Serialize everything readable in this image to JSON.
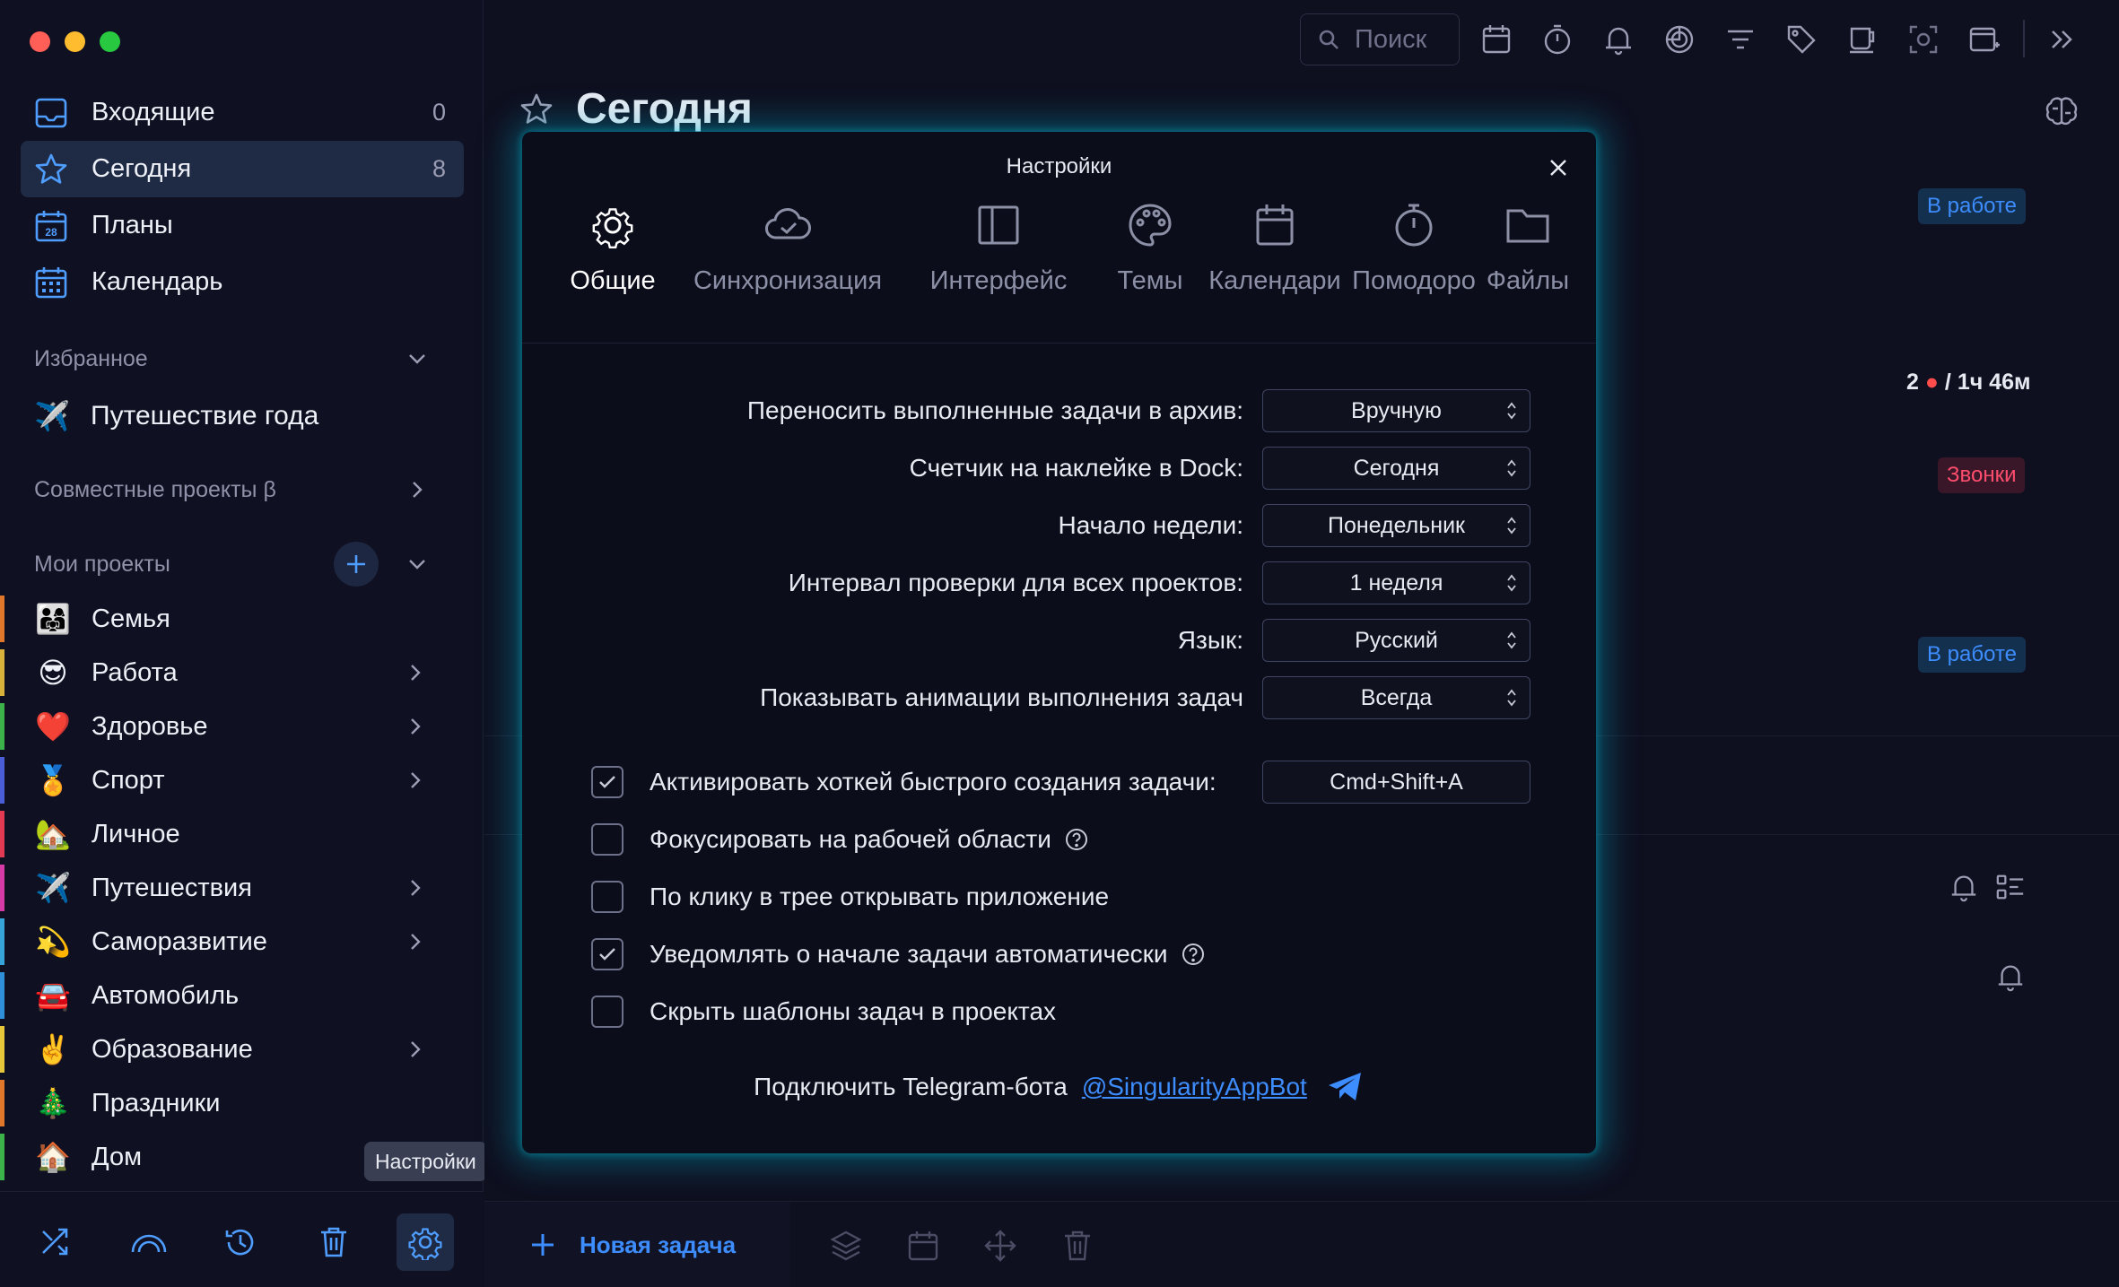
{
  "sidebar": {
    "nav": [
      {
        "label": "Входящие",
        "count": "0"
      },
      {
        "label": "Сегодня",
        "count": "8"
      },
      {
        "label": "Планы",
        "count": ""
      },
      {
        "label": "Календарь",
        "count": ""
      }
    ],
    "favorites_title": "Избранное",
    "favorites": [
      {
        "label": "Путешествие года",
        "emoji": "✈️"
      }
    ],
    "shared_title": "Совместные проекты β",
    "my_projects_title": "Мои проекты",
    "projects": [
      {
        "label": "Семья",
        "emoji": "👨‍👩‍👧",
        "color": "#e0772a",
        "expandable": false
      },
      {
        "label": "Работа",
        "emoji": "😎",
        "color": "#d8b23a",
        "expandable": true
      },
      {
        "label": "Здоровье",
        "emoji": "❤️",
        "color": "#3bb34a",
        "expandable": true
      },
      {
        "label": "Спорт",
        "emoji": "🏅",
        "color": "#4a5ed8",
        "expandable": true
      },
      {
        "label": "Личное",
        "emoji": "🏡",
        "color": "#e33a54",
        "expandable": false
      },
      {
        "label": "Путешествия",
        "emoji": "✈️",
        "color": "#d63aa6",
        "expandable": true
      },
      {
        "label": "Саморазвитие",
        "emoji": "💫",
        "color": "#36a3d9",
        "expandable": true
      },
      {
        "label": "Автомобиль",
        "emoji": "🚘",
        "color": "#2f8fd9",
        "expandable": false
      },
      {
        "label": "Образование",
        "emoji": "✌️",
        "color": "#e6c63a",
        "expandable": true
      },
      {
        "label": "Праздники",
        "emoji": "🎄",
        "color": "#e0772a",
        "expandable": false
      },
      {
        "label": "Дом",
        "emoji": "🏠",
        "color": "#3bb34a",
        "expandable": false
      }
    ],
    "tooltip": "Настройки"
  },
  "main": {
    "search_placeholder": "Поиск",
    "page_title": "Сегодня",
    "badges": {
      "in_work_1": "В работе",
      "calls": "Звонки",
      "in_work_2": "В работе"
    },
    "timer": {
      "count": "2",
      "dot": "●",
      "time": "/ 1ч 46м"
    },
    "new_task": "Новая задача"
  },
  "dialog": {
    "title": "Настройки",
    "tabs": [
      "Общие",
      "Синхронизация",
      "Интерфейс",
      "Темы",
      "Календари",
      "Помодоро",
      "Файлы"
    ],
    "active_tab": "Общие",
    "settings": [
      {
        "label": "Переносить выполненные задачи в архив:",
        "value": "Вручную"
      },
      {
        "label": "Счетчик на наклейке в Dock:",
        "value": "Сегодня"
      },
      {
        "label": "Начало недели:",
        "value": "Понедельник"
      },
      {
        "label": "Интервал проверки для всех проектов:",
        "value": "1 неделя"
      },
      {
        "label": "Язык:",
        "value": "Русский"
      },
      {
        "label": "Показывать анимации выполнения задач",
        "value": "Всегда"
      }
    ],
    "checks": [
      {
        "label": "Активировать хоткей быстрого создания задачи:",
        "checked": true
      },
      {
        "label": "Фокусировать на рабочей области",
        "checked": false
      },
      {
        "label": "По клику в трее открывать приложение",
        "checked": false
      },
      {
        "label": "Уведомлять о начале задачи автоматически",
        "checked": true
      },
      {
        "label": "Скрыть шаблоны задач в проектах",
        "checked": false
      }
    ],
    "hotkey": "Cmd+Shift+A",
    "telegram": {
      "label": "Подключить Telegram-бота",
      "link": "@SingularityAppBot"
    }
  },
  "colors": {
    "accent": "#3d8dff",
    "glow": "#00bedc",
    "active_bg": "#1f2a44"
  }
}
